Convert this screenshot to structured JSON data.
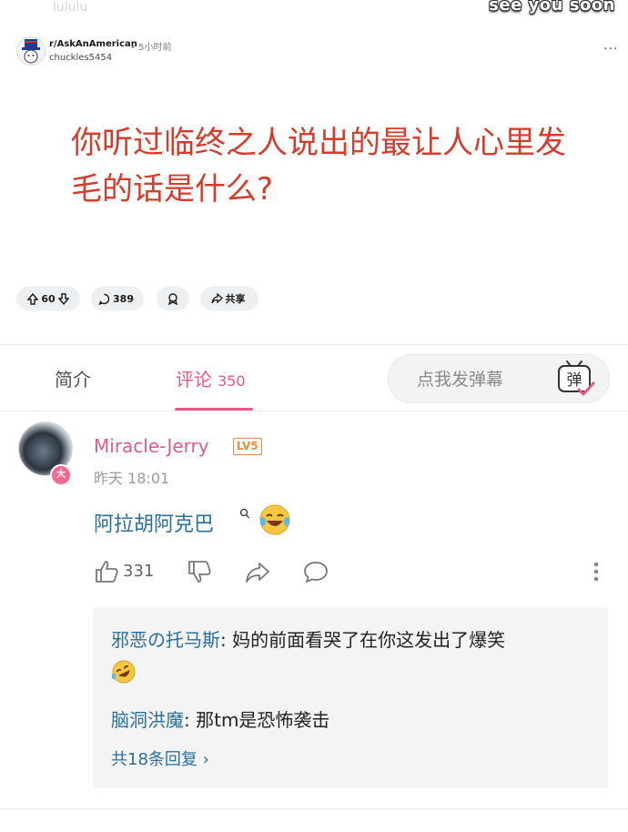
{
  "video": {
    "watermark": "lululu",
    "overlay_caption": "see you soon",
    "post": {
      "subreddit": "r/AskAnAmerican",
      "time": "• 5小时前",
      "user": "chuckles5454",
      "more": "···",
      "title": "你听过临终之人说出的最让人心里发毛的话是什么?",
      "votes": "60",
      "comments": "389",
      "share": "共享"
    }
  },
  "tabs": {
    "intro": "简介",
    "comments": "评论",
    "comments_count": "350",
    "danmaku_placeholder": "点我发弹幕",
    "danmaku_icon_char": "弹"
  },
  "comment": {
    "user": "Miracle-Jerry",
    "level": "LV5",
    "badge": "大",
    "time": "昨天 18:01",
    "text": "阿拉胡阿克巴",
    "likes": "331",
    "replies": [
      {
        "user": "邪恶の托马斯",
        "sep": ": ",
        "text": "妈的前面看哭了在你这发出了爆笑"
      },
      {
        "user": "脑洞洪魔",
        "sep": ": ",
        "text": "那tm是恐怖袭击"
      }
    ],
    "reply_total": "共18条回复 ›"
  },
  "colors": {
    "accent_pink": "#e25a86",
    "link_blue": "#2a6f9a",
    "title_red": "#d43c2c",
    "level_orange": "#f08a3a"
  }
}
